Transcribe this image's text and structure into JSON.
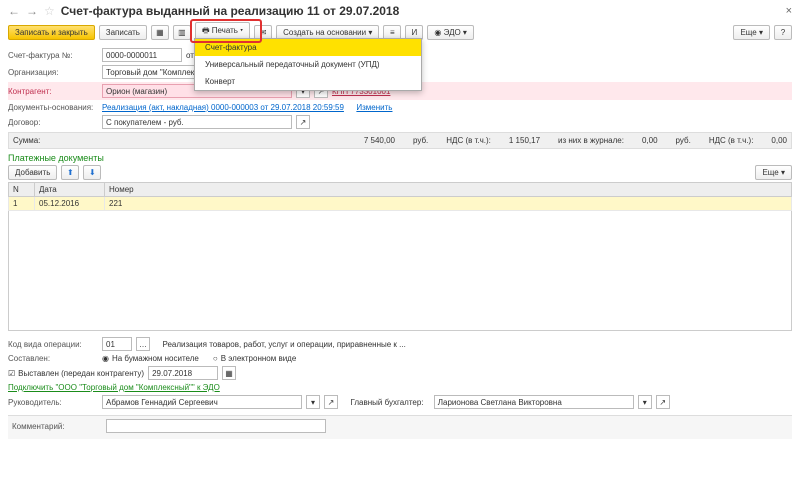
{
  "header": {
    "title": "Счет-фактура выданный на реализацию 11 от 29.07.2018"
  },
  "toolbar": {
    "save_close": "Записать и закрыть",
    "save": "Записать",
    "print": "Печать",
    "create_based": "Создать на основании",
    "edo": "ЭДО",
    "more": "Еще"
  },
  "dropdown": {
    "item1": "Счет-фактура",
    "item2": "Универсальный передаточный документ (УПД)",
    "item3": "Конверт"
  },
  "form": {
    "number_lbl": "Счет-фактура №:",
    "number": "0000-0000011",
    "date_lbl": "от:",
    "org_lbl": "Организация:",
    "org": "Торговый дом \"Комплексный",
    "counter_lbl": "Контрагент:",
    "counter": "Орион (магазин)",
    "kpp": "КПП 773301001",
    "docs_lbl": "Документы-основания:",
    "docs_link": "Реализация (акт, накладная) 0000-000003 от 29.07.2018 20:59:59",
    "docs_change": "Изменить",
    "contract_lbl": "Договор:",
    "contract": "С покупателем - руб."
  },
  "totals": {
    "sum_lbl": "Сумма:",
    "sum": "7 540,00",
    "cur": "руб.",
    "nds_lbl": "НДС (в т.ч.):",
    "nds": "1 150,17",
    "journal_lbl": "из них в журнале:",
    "jsum": "0,00",
    "jcur": "руб.",
    "jnds_lbl": "НДС (в т.ч.):",
    "jnds": "0,00"
  },
  "payments": {
    "section": "Платежные документы",
    "add": "Добавить",
    "more": "Еще",
    "col_n": "N",
    "col_date": "Дата",
    "col_num": "Номер",
    "row_n": "1",
    "row_date": "05.12.2016",
    "row_num": "221"
  },
  "bottom": {
    "optype_lbl": "Код вида операции:",
    "optype": "01",
    "optype_desc": "Реализация товаров, работ, услуг и операции, приравненные к ...",
    "composed_lbl": "Составлен:",
    "radio1": "На бумажном носителе",
    "radio2": "В электронном виде",
    "issued": "Выставлен (передан контрагенту)",
    "issued_date": "29.07.2018",
    "edo_link": "Подключить \"ООО \"Торговый дом \"Комплексный\"\" к ЭДО",
    "head_lbl": "Руководитель:",
    "head": "Абрамов Геннадий Сергеевич",
    "acc_lbl": "Главный бухгалтер:",
    "acc": "Ларионова Светлана Викторовна",
    "comment_lbl": "Комментарий:"
  }
}
